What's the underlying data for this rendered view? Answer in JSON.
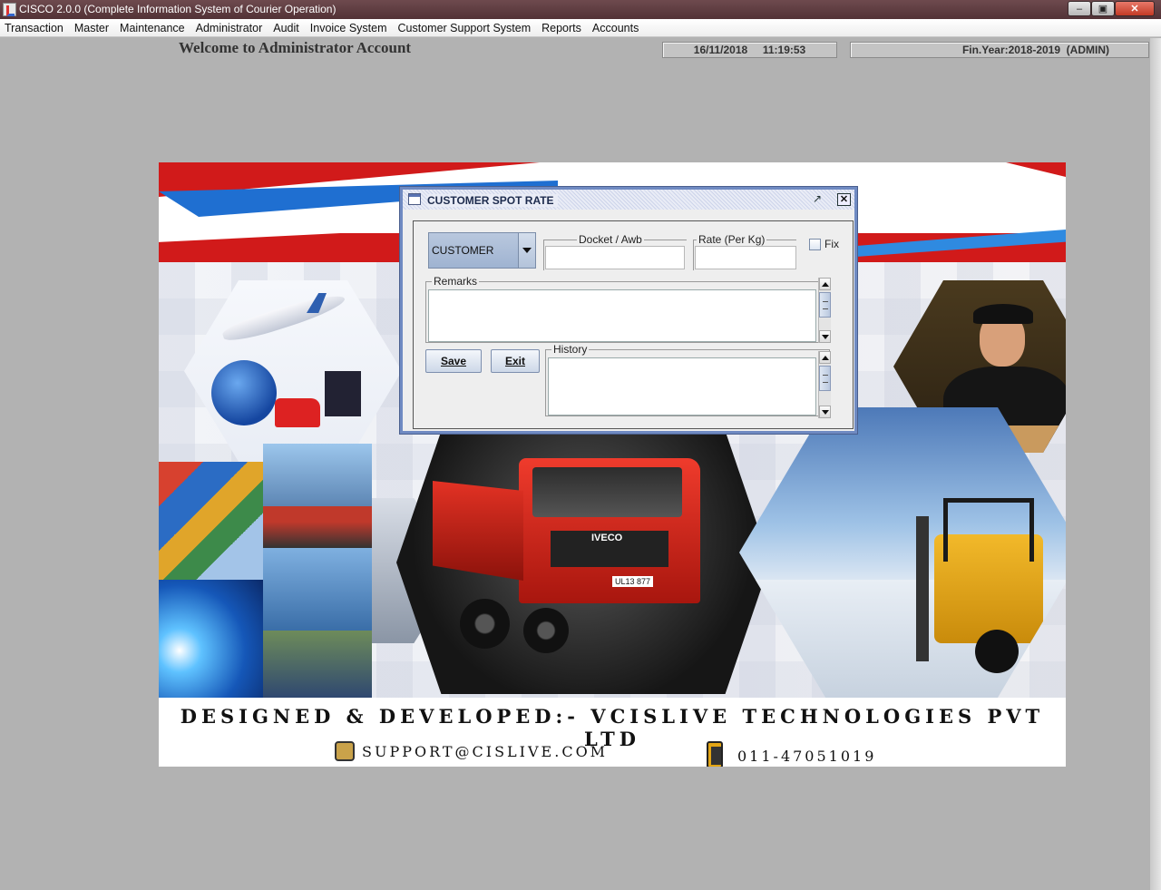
{
  "window": {
    "title": "CISCO 2.0.0 (Complete Information System of Courier Operation)",
    "minimize_glyph": "–",
    "maximize_glyph": "▣",
    "close_glyph": "✕"
  },
  "menu": [
    "Transaction",
    "Master",
    "Maintenance",
    "Administrator",
    "Audit",
    "Invoice System",
    "Customer Support System",
    "Reports",
    "Accounts"
  ],
  "header": {
    "welcome": "Welcome to Administrator Account",
    "datetime": "16/11/2018     11:19:53",
    "fin_year": "Fin.Year:2018-2019  (ADMIN)"
  },
  "banner": {
    "credit": "DESIGNED & DEVELOPED:- VCISLIVE TECHNOLOGIES PVT LTD",
    "email": "SUPPORT@CISLIVE.COM",
    "phone": "011-47051019",
    "truck_brand": "IVECO",
    "truck_plate": "UL13 877"
  },
  "dialog": {
    "title": "CUSTOMER SPOT RATE",
    "close_glyph": "✕",
    "restore_glyph": "↗",
    "combo_value": "CUSTOMER",
    "docket_label": "Docket / Awb",
    "rate_label": "Rate (Per Kg)",
    "fix_label": "Fix",
    "remarks_label": "Remarks",
    "history_label": "History",
    "save_label": "Save",
    "exit_label": "Exit"
  },
  "colors": {
    "desktop": "#b2b2b2",
    "titlebar": "#5e3d41",
    "dialog_border": "#6f8ac2",
    "truck_red": "#d62418",
    "forklift_yellow": "#e3a514"
  }
}
